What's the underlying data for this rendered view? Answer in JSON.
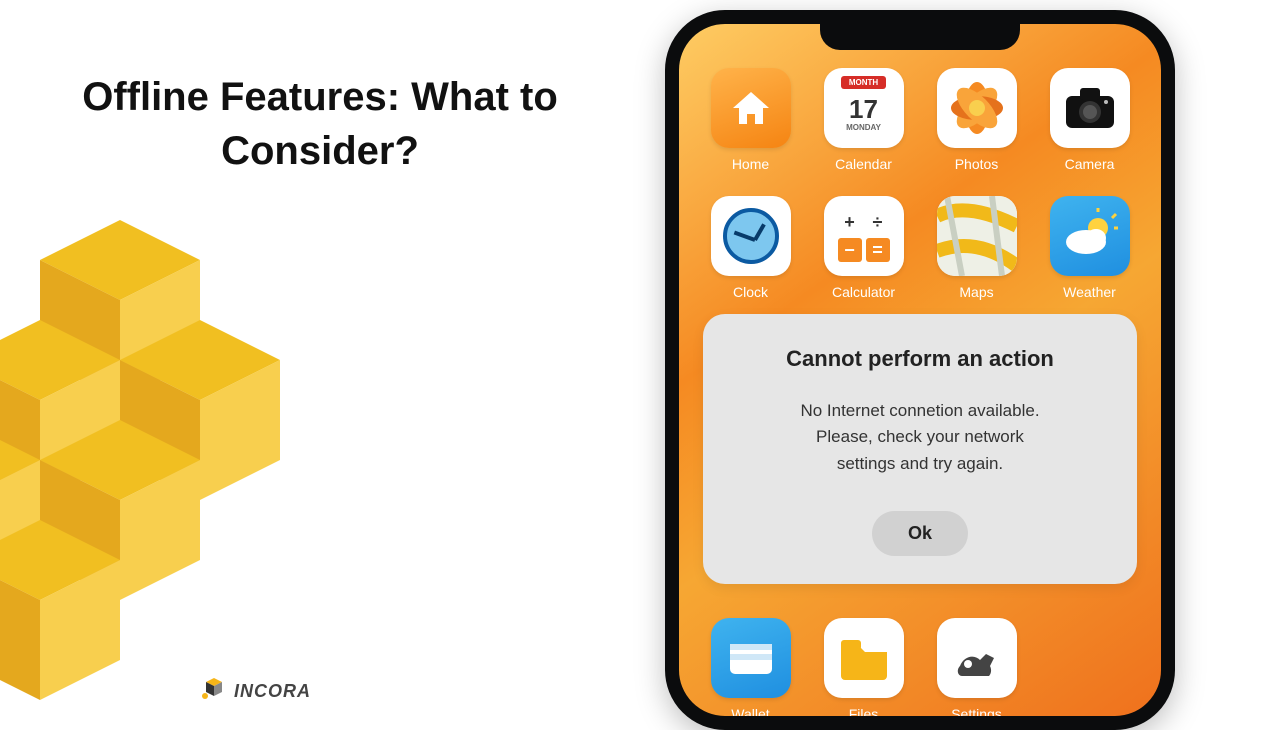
{
  "title": "Offline Features: What to Consider?",
  "logo": "INCORA",
  "apps_row1": [
    {
      "label": "Home"
    },
    {
      "label": "Calendar",
      "month": "MONTH",
      "day": "17",
      "weekday": "MONDAY"
    },
    {
      "label": "Photos"
    },
    {
      "label": "Camera"
    }
  ],
  "apps_row2": [
    {
      "label": "Clock"
    },
    {
      "label": "Calculator"
    },
    {
      "label": "Maps"
    },
    {
      "label": "Weather"
    }
  ],
  "apps_bottom": [
    {
      "label": "Wallet"
    },
    {
      "label": "Files"
    },
    {
      "label": "Settings"
    }
  ],
  "dialog": {
    "title": "Cannot perform an action",
    "body": "No Internet connetion available.\nPlease, check your network\nsettings and try again.",
    "ok": "Ok"
  }
}
